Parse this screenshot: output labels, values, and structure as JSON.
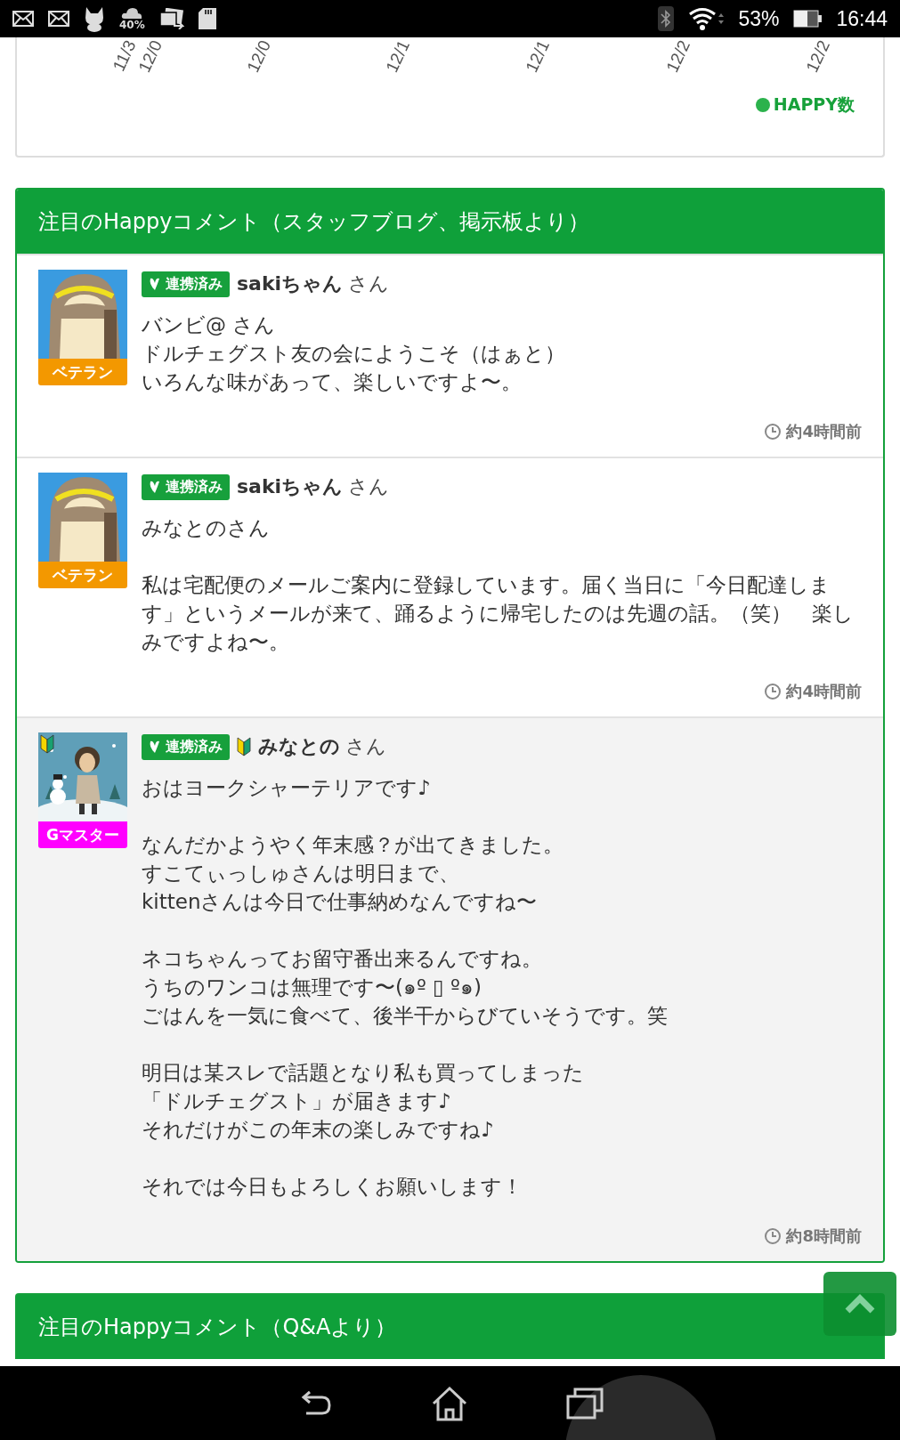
{
  "status_bar": {
    "weather_percent": "40%",
    "battery_percent": "53%",
    "time": "16:44"
  },
  "chart": {
    "tick_labels": [
      "11/3",
      "12/0",
      "12/0",
      "12/1",
      "12/1",
      "12/2",
      "12/2"
    ],
    "legend": "HAPPY数"
  },
  "sections": [
    {
      "title": "注目のHappyコメント（スタッフブログ、掲示板より）",
      "comments": [
        {
          "rank": "ベテラン",
          "color": "#f39800",
          "linked_label": "連携済み",
          "beginner": false,
          "name": "sakiちゃん",
          "honorific": "さん",
          "highlighted": false,
          "paragraphs": [
            [
              "バンビ@ さん",
              "ドルチェグスト友の会にようこそ（はぁと）",
              "いろんな味があって、楽しいですよ〜。"
            ]
          ],
          "time": "約4時間前"
        },
        {
          "rank": "ベテラン",
          "color": "#f39800",
          "linked_label": "連携済み",
          "beginner": false,
          "name": "sakiちゃん",
          "honorific": "さん",
          "highlighted": false,
          "paragraphs": [
            [
              "みなとのさん"
            ],
            [
              "私は宅配便のメールご案内に登録しています。届く当日に「今日配達します」というメールが来て、踊るように帰宅したのは先週の話。（笑）　楽しみですよね〜。"
            ]
          ],
          "time": "約4時間前"
        },
        {
          "rank": "Gマスター",
          "color": "#ff00ff",
          "linked_label": "連携済み",
          "beginner": true,
          "name": "みなとの",
          "honorific": "さん",
          "highlighted": true,
          "paragraphs": [
            [
              "おはヨークシャーテリアです♪"
            ],
            [
              "なんだかようやく年末感？が出てきました。",
              "すこてぃっしゅさんは明日まで、",
              "kittenさんは今日で仕事納めなんですね〜"
            ],
            [
              "ネコちゃんってお留守番出来るんですね。",
              "うちのワンコは無理です〜(๑º ▯ º๑)",
              "ごはんを一気に食べて、後半干からびていそうです。笑"
            ],
            [
              "明日は某スレで話題となり私も買ってしまった",
              "「ドルチェグスト」が届きます♪",
              "それだけがこの年末の楽しみですね♪"
            ],
            [
              "それでは今日もよろしくお願いします！"
            ]
          ],
          "time": "約8時間前"
        }
      ]
    },
    {
      "title": "注目のHappyコメント（Q&Aより）"
    }
  ]
}
